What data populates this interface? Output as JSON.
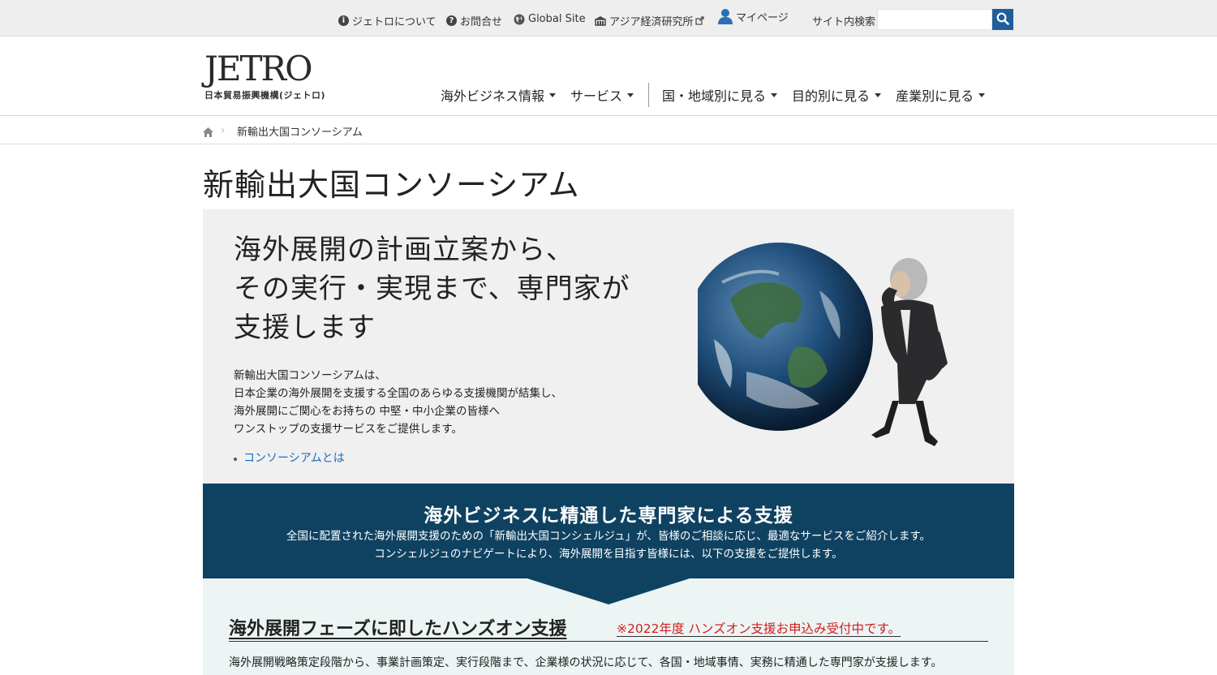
{
  "utility": {
    "about": "ジェトロについて",
    "contact": "お問合せ",
    "global": "Global Site",
    "ide": "アジア経済研究所",
    "mypage": "マイページ",
    "search_label": "サイト内検索",
    "search_placeholder": ""
  },
  "header": {
    "logo_mark": "JETRO",
    "logo_sub": "日本貿易振興機構(ジェトロ)"
  },
  "nav": {
    "overseas_business": "海外ビジネス情報",
    "services": "サービス",
    "by_region": "国・地域別に見る",
    "by_purpose": "目的別に見る",
    "by_industry": "産業別に見る"
  },
  "breadcrumb": {
    "current": "新輸出大国コンソーシアム"
  },
  "page_title": "新輸出大国コンソーシアム",
  "hero": {
    "heading_lines": [
      "海外展開の計画立案から、",
      "その実行・実現まで、専門家が",
      "支援します"
    ],
    "desc_lines": [
      "新輸出大国コンソーシアムは、",
      "日本企業の海外展開を支援する全国のあらゆる支援機関が結集し、",
      "海外展開にご関心をお持ちの 中堅・中小企業の皆様へ",
      "ワンストップの支援サービスをご提供します。"
    ],
    "link": "コンソーシアムとは"
  },
  "support_band": {
    "title": "海外ビジネスに精通した専門家による支援",
    "lines": [
      "全国に配置された海外展開支援のための「新輸出大国コンシェルジュ」が、皆様のご相談に応じ、最適なサービスをご紹介します。",
      "コンシェルジュのナビゲートにより、海外展開を目指す皆様には、以下の支援をご提供します。"
    ]
  },
  "handson": {
    "heading": "海外展開フェーズに即したハンズオン支援",
    "note": "※2022年度 ハンズオン支援お申込み受付中です。",
    "body": "海外展開戦略策定段階から、事業計画策定、実行段階まで、企業様の状況に応じて、各国・地域事情、実務に精通した専門家が支援します。"
  },
  "colors": {
    "band": "#0f4261",
    "accent_link": "#1a6dc0",
    "notice_red": "#d21e1e",
    "search_button": "#1e5e9c"
  }
}
